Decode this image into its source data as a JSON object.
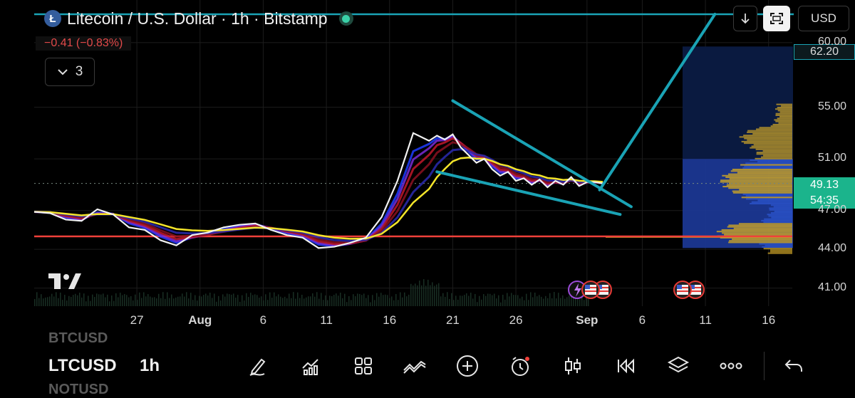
{
  "header": {
    "coin_letter": "Ł",
    "title": "Litecoin / U.S. Dollar · 1h · Bitstamp",
    "change": "−0.41 (−0.83%)",
    "indicators_count": "3"
  },
  "toolbar_top": {
    "currency": "USD"
  },
  "price_tags": {
    "target": "62.20",
    "last": "49.13",
    "countdown": "54:35"
  },
  "colors": {
    "accent_teal": "#1aa3b5",
    "support_red": "#f0403a",
    "price_tag_green": "#1bb48c",
    "profile_gold": "#c9a227",
    "profile_blue": "#2a52c8"
  },
  "bottom_bar": {
    "ghost_above": "BTCUSD",
    "symbol": "LTCUSD",
    "interval": "1h",
    "ghost_below": "NOTUSD",
    "tools": [
      "pencil-icon",
      "indicators-icon",
      "grid-icon",
      "trend-icon",
      "add-icon",
      "alert-icon",
      "candles-icon",
      "replay-icon",
      "layers-icon",
      "more-icon",
      "undo-icon"
    ]
  },
  "chart_data": {
    "type": "line",
    "symbol": "LTCUSD",
    "interval": "1h",
    "y_ticks": [
      "60.00",
      "55.00",
      "51.00",
      "47.00",
      "44.00",
      "41.00"
    ],
    "x_ticks": [
      "27",
      "Aug",
      "6",
      "11",
      "16",
      "21",
      "26",
      "Sep",
      "6",
      "11",
      "16"
    ],
    "ylim": [
      39.6,
      63.3
    ],
    "xlim": [
      -4.5,
      43.5
    ],
    "price_series": {
      "name": "",
      "x": [
        -4.5,
        -3.5,
        -2.5,
        -1.5,
        -0.5,
        0.5,
        1.5,
        2.5,
        3.5,
        4.5,
        5.5,
        6.5,
        7.5,
        8.5,
        9.5,
        10.5,
        11.5,
        12.5,
        13.5,
        14.5,
        15.5,
        16.5,
        17.5,
        18.5,
        19.5,
        20.5,
        21,
        21.5,
        22,
        22.5,
        23,
        23.5,
        24,
        24.5,
        25,
        25.5,
        26,
        26.5,
        27,
        27.5,
        28,
        28.5,
        29,
        29.5,
        30,
        30.5,
        31,
        31.5
      ],
      "y": [
        46.9,
        46.8,
        46.3,
        46.2,
        47.1,
        46.7,
        45.7,
        45.5,
        44.7,
        44.3,
        45.1,
        45.3,
        45.7,
        45.9,
        46.0,
        45.5,
        45.1,
        44.9,
        44.1,
        44.2,
        44.5,
        44.9,
        46.5,
        49.3,
        53.0,
        52.4,
        52.8,
        52.5,
        52.9,
        51.9,
        51.3,
        50.7,
        51.0,
        50.2,
        49.7,
        50.0,
        49.3,
        49.5,
        49.0,
        49.4,
        48.8,
        49.3,
        49.0,
        49.6,
        48.9,
        49.2,
        49.2,
        49.1
      ]
    },
    "support_level": 45.0,
    "target_level": 62.2,
    "wedge_upper": [
      [
        22,
        55.5
      ],
      [
        33.3,
        47.3
      ]
    ],
    "wedge_lower": [
      [
        21,
        50.0
      ],
      [
        32.6,
        46.7
      ]
    ],
    "projection": [
      [
        31.3,
        48.6
      ],
      [
        38.6,
        62.2
      ]
    ]
  }
}
